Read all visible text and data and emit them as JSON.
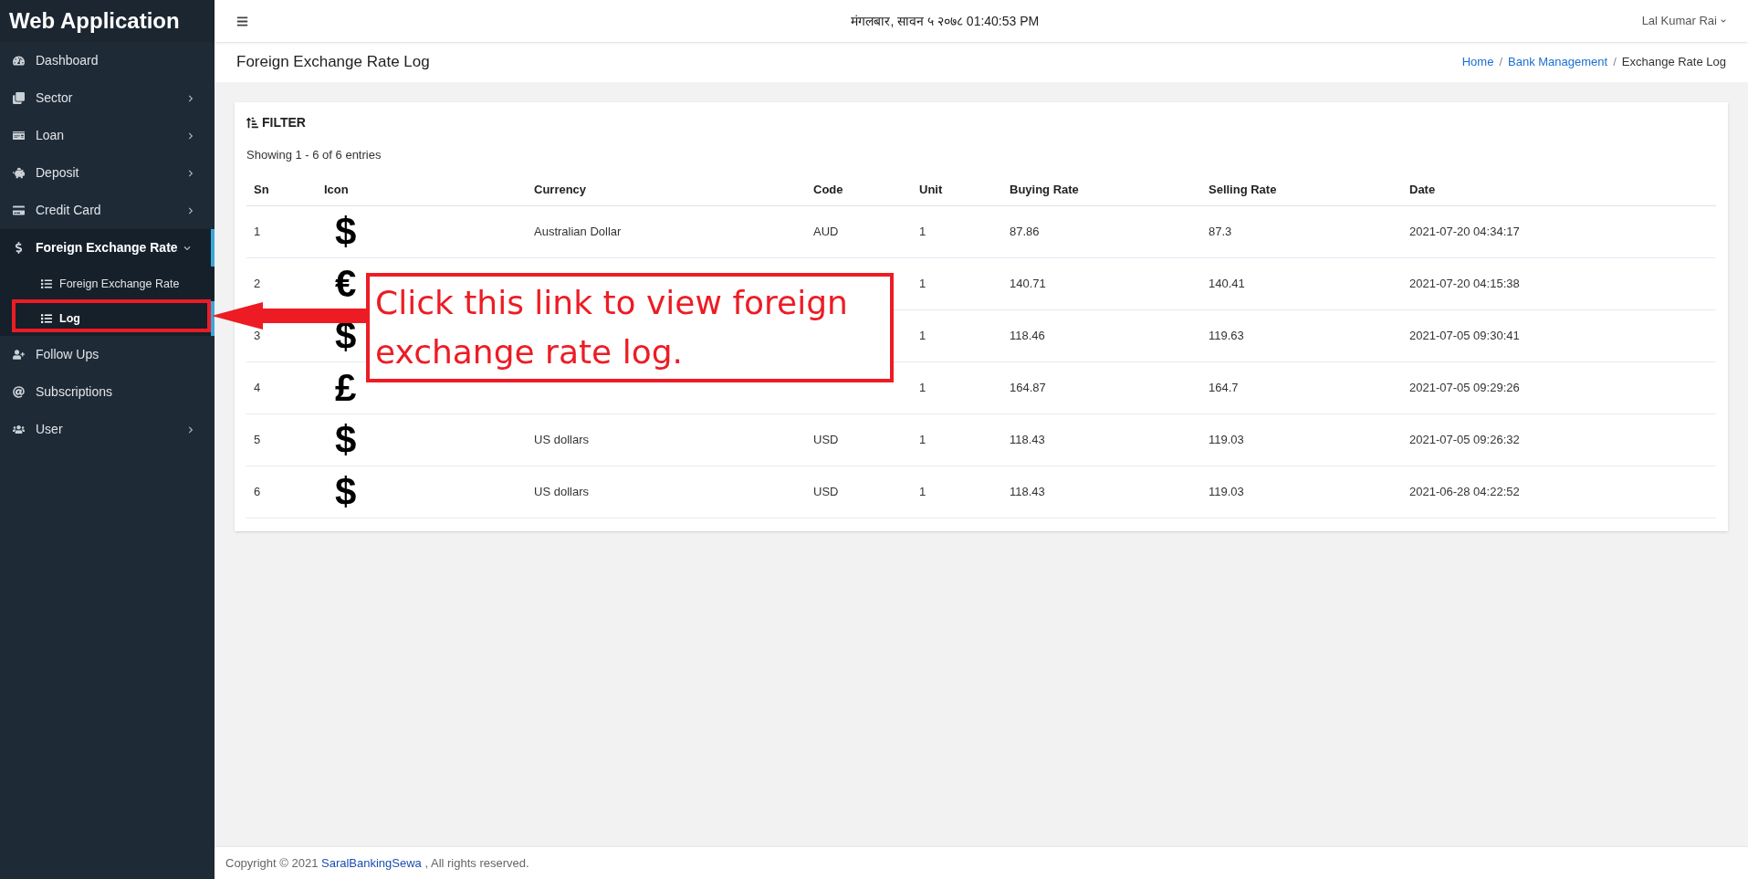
{
  "sidebar": {
    "title": "Web Application",
    "items": [
      {
        "label": "Dashboard",
        "has_submenu": false,
        "expanded": false
      },
      {
        "label": "Sector",
        "has_submenu": true,
        "expanded": false
      },
      {
        "label": "Loan",
        "has_submenu": true,
        "expanded": false
      },
      {
        "label": "Deposit",
        "has_submenu": true,
        "expanded": false
      },
      {
        "label": "Credit Card",
        "has_submenu": true,
        "expanded": false
      },
      {
        "label": "Foreign Exchange Rate",
        "has_submenu": true,
        "expanded": true,
        "children": [
          {
            "label": "Foreign Exchange Rate",
            "selected": false
          },
          {
            "label": "Log",
            "selected": true
          }
        ]
      },
      {
        "label": "Follow Ups",
        "has_submenu": false,
        "expanded": false
      },
      {
        "label": "Subscriptions",
        "has_submenu": false,
        "expanded": false
      },
      {
        "label": "User",
        "has_submenu": true,
        "expanded": false
      }
    ]
  },
  "header": {
    "datetime": "मंगलबार, सावन ५ २०७८ 01:40:53 PM",
    "user": "Lal Kumar Rai"
  },
  "page_title": "Foreign Exchange Rate Log",
  "breadcrumb": [
    {
      "label": "Home",
      "kind": "link"
    },
    {
      "label": "/",
      "kind": "separator"
    },
    {
      "label": "Bank Management",
      "kind": "link"
    },
    {
      "label": "/",
      "kind": "separator"
    },
    {
      "label": "Exchange Rate Log",
      "kind": "current"
    }
  ],
  "filter_label": "FILTER",
  "entries_info": "Showing 1 - 6 of 6 entries",
  "table": {
    "columns": [
      "Sn",
      "Icon",
      "Currency",
      "Code",
      "Unit",
      "Buying Rate",
      "Selling Rate",
      "Date"
    ],
    "rows": [
      {
        "sn": "1",
        "icon": "$",
        "currency": "Australian Dollar",
        "code": "AUD",
        "unit": "1",
        "buying": "87.86",
        "selling": "87.3",
        "date": "2021-07-20 04:34:17"
      },
      {
        "sn": "2",
        "icon": "€",
        "unit": "1",
        "buying": "140.71",
        "selling": "140.41",
        "date": "2021-07-20 04:15:38"
      },
      {
        "sn": "3",
        "icon": "$",
        "unit": "1",
        "buying": "118.46",
        "selling": "119.63",
        "date": "2021-07-05 09:30:41"
      },
      {
        "sn": "4",
        "icon": "£",
        "unit": "1",
        "buying": "164.87",
        "selling": "164.7",
        "date": "2021-07-05 09:29:26"
      },
      {
        "sn": "5",
        "icon": "$",
        "currency": "US dollars",
        "code": "USD",
        "unit": "1",
        "buying": "118.43",
        "selling": "119.03",
        "date": "2021-07-05 09:26:32"
      },
      {
        "sn": "6",
        "icon": "$",
        "currency": "US dollars",
        "code": "USD",
        "unit": "1",
        "buying": "118.43",
        "selling": "119.03",
        "date": "2021-06-28 04:22:52"
      }
    ]
  },
  "annotation": {
    "text": "Click this link to view foreign exchange rate log."
  },
  "footer": {
    "prefix": "Copyright © 2021",
    "link": "SaralBankingSewa",
    "suffix": ", All rights reserved."
  }
}
